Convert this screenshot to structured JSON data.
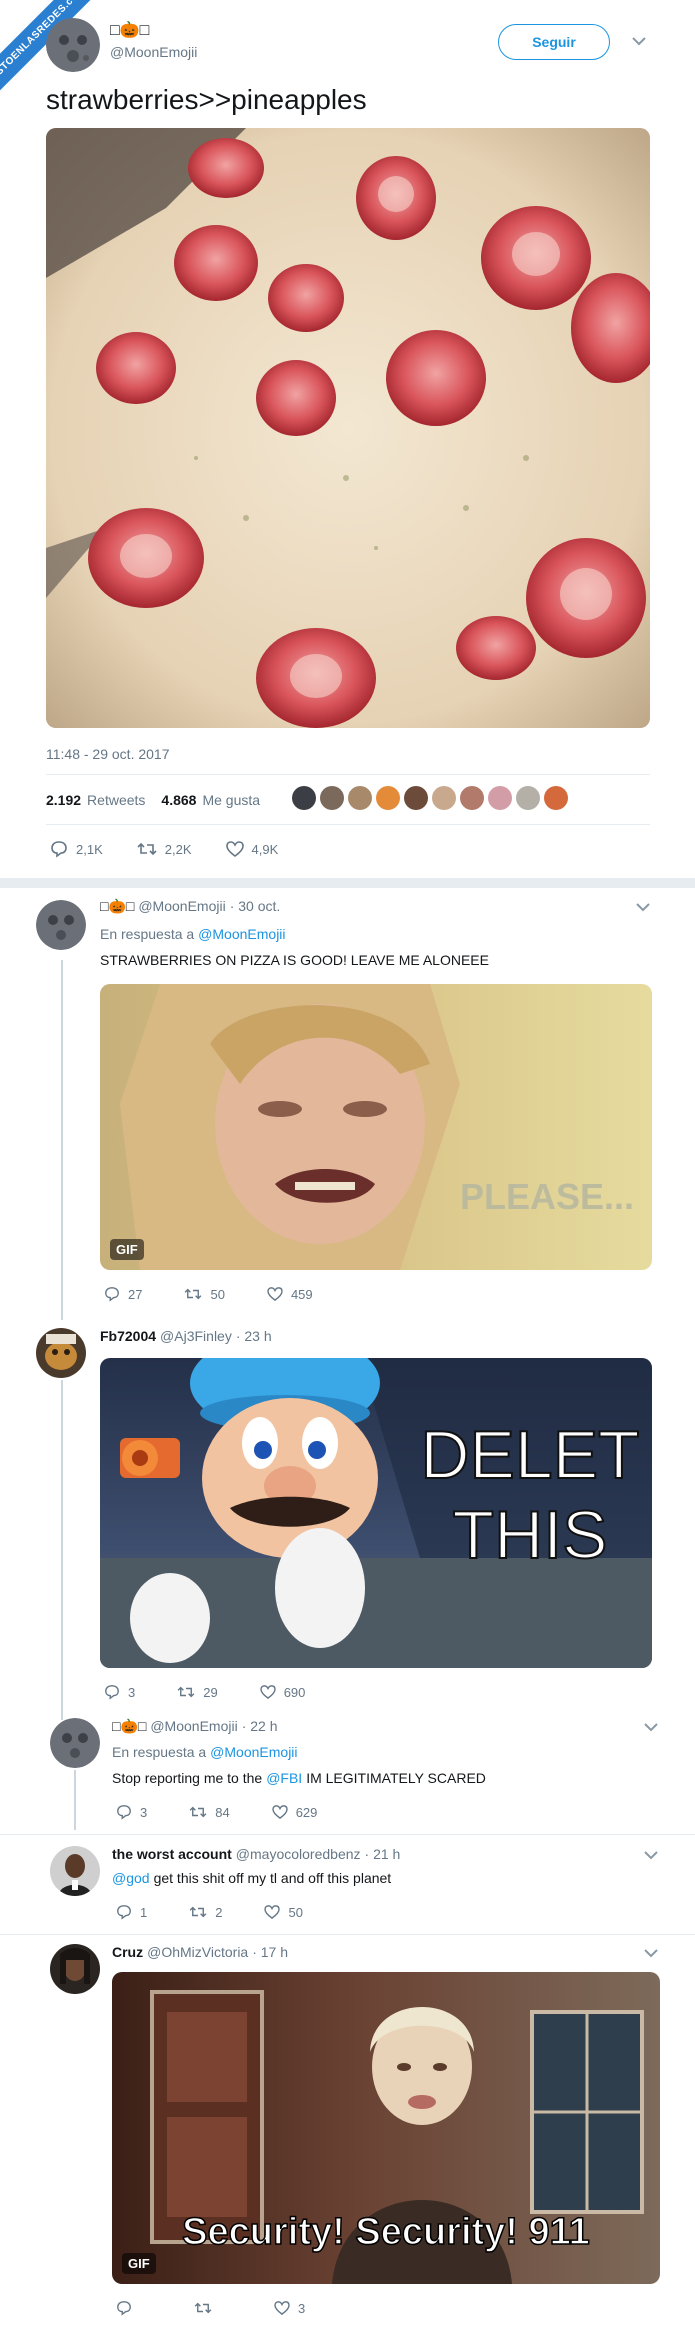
{
  "ribbon": "VISTOENLASREDES.com",
  "main_tweet": {
    "display_name": "□🎃□",
    "handle": "@MoonEmojii",
    "follow_label": "Seguir",
    "text": "strawberries>>pineapples",
    "timestamp": "11:48 - 29 oct. 2017",
    "retweets_count": "2.192",
    "retweets_label": "Retweets",
    "likes_count": "4.868",
    "likes_label": "Me gusta",
    "reply_count": "2,1K",
    "retweet_action_count": "2,2K",
    "like_action_count": "4,9K"
  },
  "replies": [
    {
      "display_name": "□🎃□",
      "handle": "@MoonEmojii",
      "time": "· 30 oct.",
      "in_reply_prefix": "En respuesta a",
      "in_reply_handle": "@MoonEmojii",
      "text": "STRAWBERRIES ON PIZZA IS GOOD! LEAVE ME ALONEEE",
      "media_overlay": "PLEASE...",
      "media_badge": "GIF",
      "replies": "27",
      "retweets": "50",
      "likes": "459"
    },
    {
      "display_name": "Fb72004",
      "handle": "@Aj3Finley",
      "time": "· 23 h",
      "media_overlay_line1": "DELET",
      "media_overlay_line2": "THIS",
      "replies": "3",
      "retweets": "29",
      "likes": "690"
    },
    {
      "display_name": "□🎃□",
      "handle": "@MoonEmojii",
      "time": "· 22 h",
      "in_reply_prefix": "En respuesta a",
      "in_reply_handle": "@MoonEmojii",
      "text_prefix": "Stop reporting me to the",
      "text_link": "@FBI",
      "text_suffix": "IM LEGITIMATELY SCARED",
      "replies": "3",
      "retweets": "84",
      "likes": "629"
    },
    {
      "display_name": "the worst account",
      "handle": "@mayocoloredbenz",
      "time": "· 21 h",
      "text_link": "@god",
      "text_suffix": "get this shit off my tl and off this planet",
      "replies": "1",
      "retweets": "2",
      "likes": "50"
    },
    {
      "display_name": "Cruz",
      "handle": "@OhMizVictoria",
      "time": "· 17 h",
      "media_overlay": "Security! Security! 911",
      "media_badge": "GIF",
      "likes": "3"
    }
  ],
  "colors": {
    "link": "#1b95e0",
    "muted": "#657786",
    "border": "#e6ecf0"
  }
}
